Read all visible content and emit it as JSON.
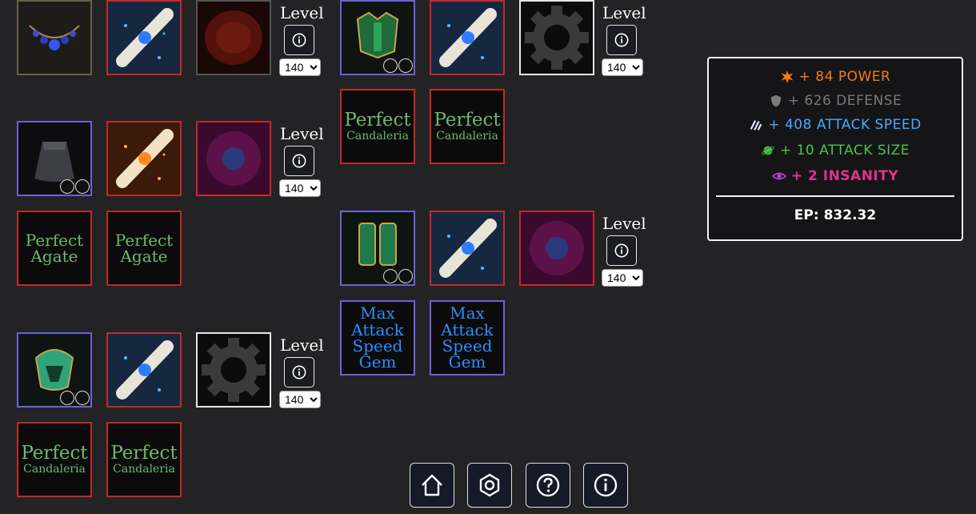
{
  "level_label": "Level",
  "level_options": [
    "140"
  ],
  "gem_text": {
    "perfect": "Perfect",
    "candaleria": "Candaleria",
    "agate": "Agate",
    "max": "Max",
    "attack": "Attack",
    "speed": "Speed",
    "gem": "Gem"
  },
  "levels": {
    "necklace": "140",
    "chest": "140",
    "cape": "140",
    "boots": "140",
    "helmet": "140"
  },
  "stats": {
    "power": {
      "text": "+ 84 POWER",
      "color": "#f07c1a"
    },
    "defense": {
      "text": "+ 626 DEFENSE",
      "color": "#7a7a7a"
    },
    "attack_speed": {
      "text": "+ 408 ATTACK SPEED",
      "color": "#4aa8ff"
    },
    "attack_size": {
      "text": "+ 10 ATTACK SIZE",
      "color": "#4cc34c"
    },
    "insanity": {
      "text": "+ 2 INSANITY",
      "color": "#e0338c"
    },
    "ep": "EP: 832.32"
  },
  "icons": [
    "home-icon",
    "settings-hexagon-icon",
    "help-icon",
    "info-icon",
    "star-burst-icon",
    "shield-icon",
    "speed-lines-icon",
    "planet-icon",
    "eye-icon",
    "gear-icon",
    "scroll-icon"
  ]
}
